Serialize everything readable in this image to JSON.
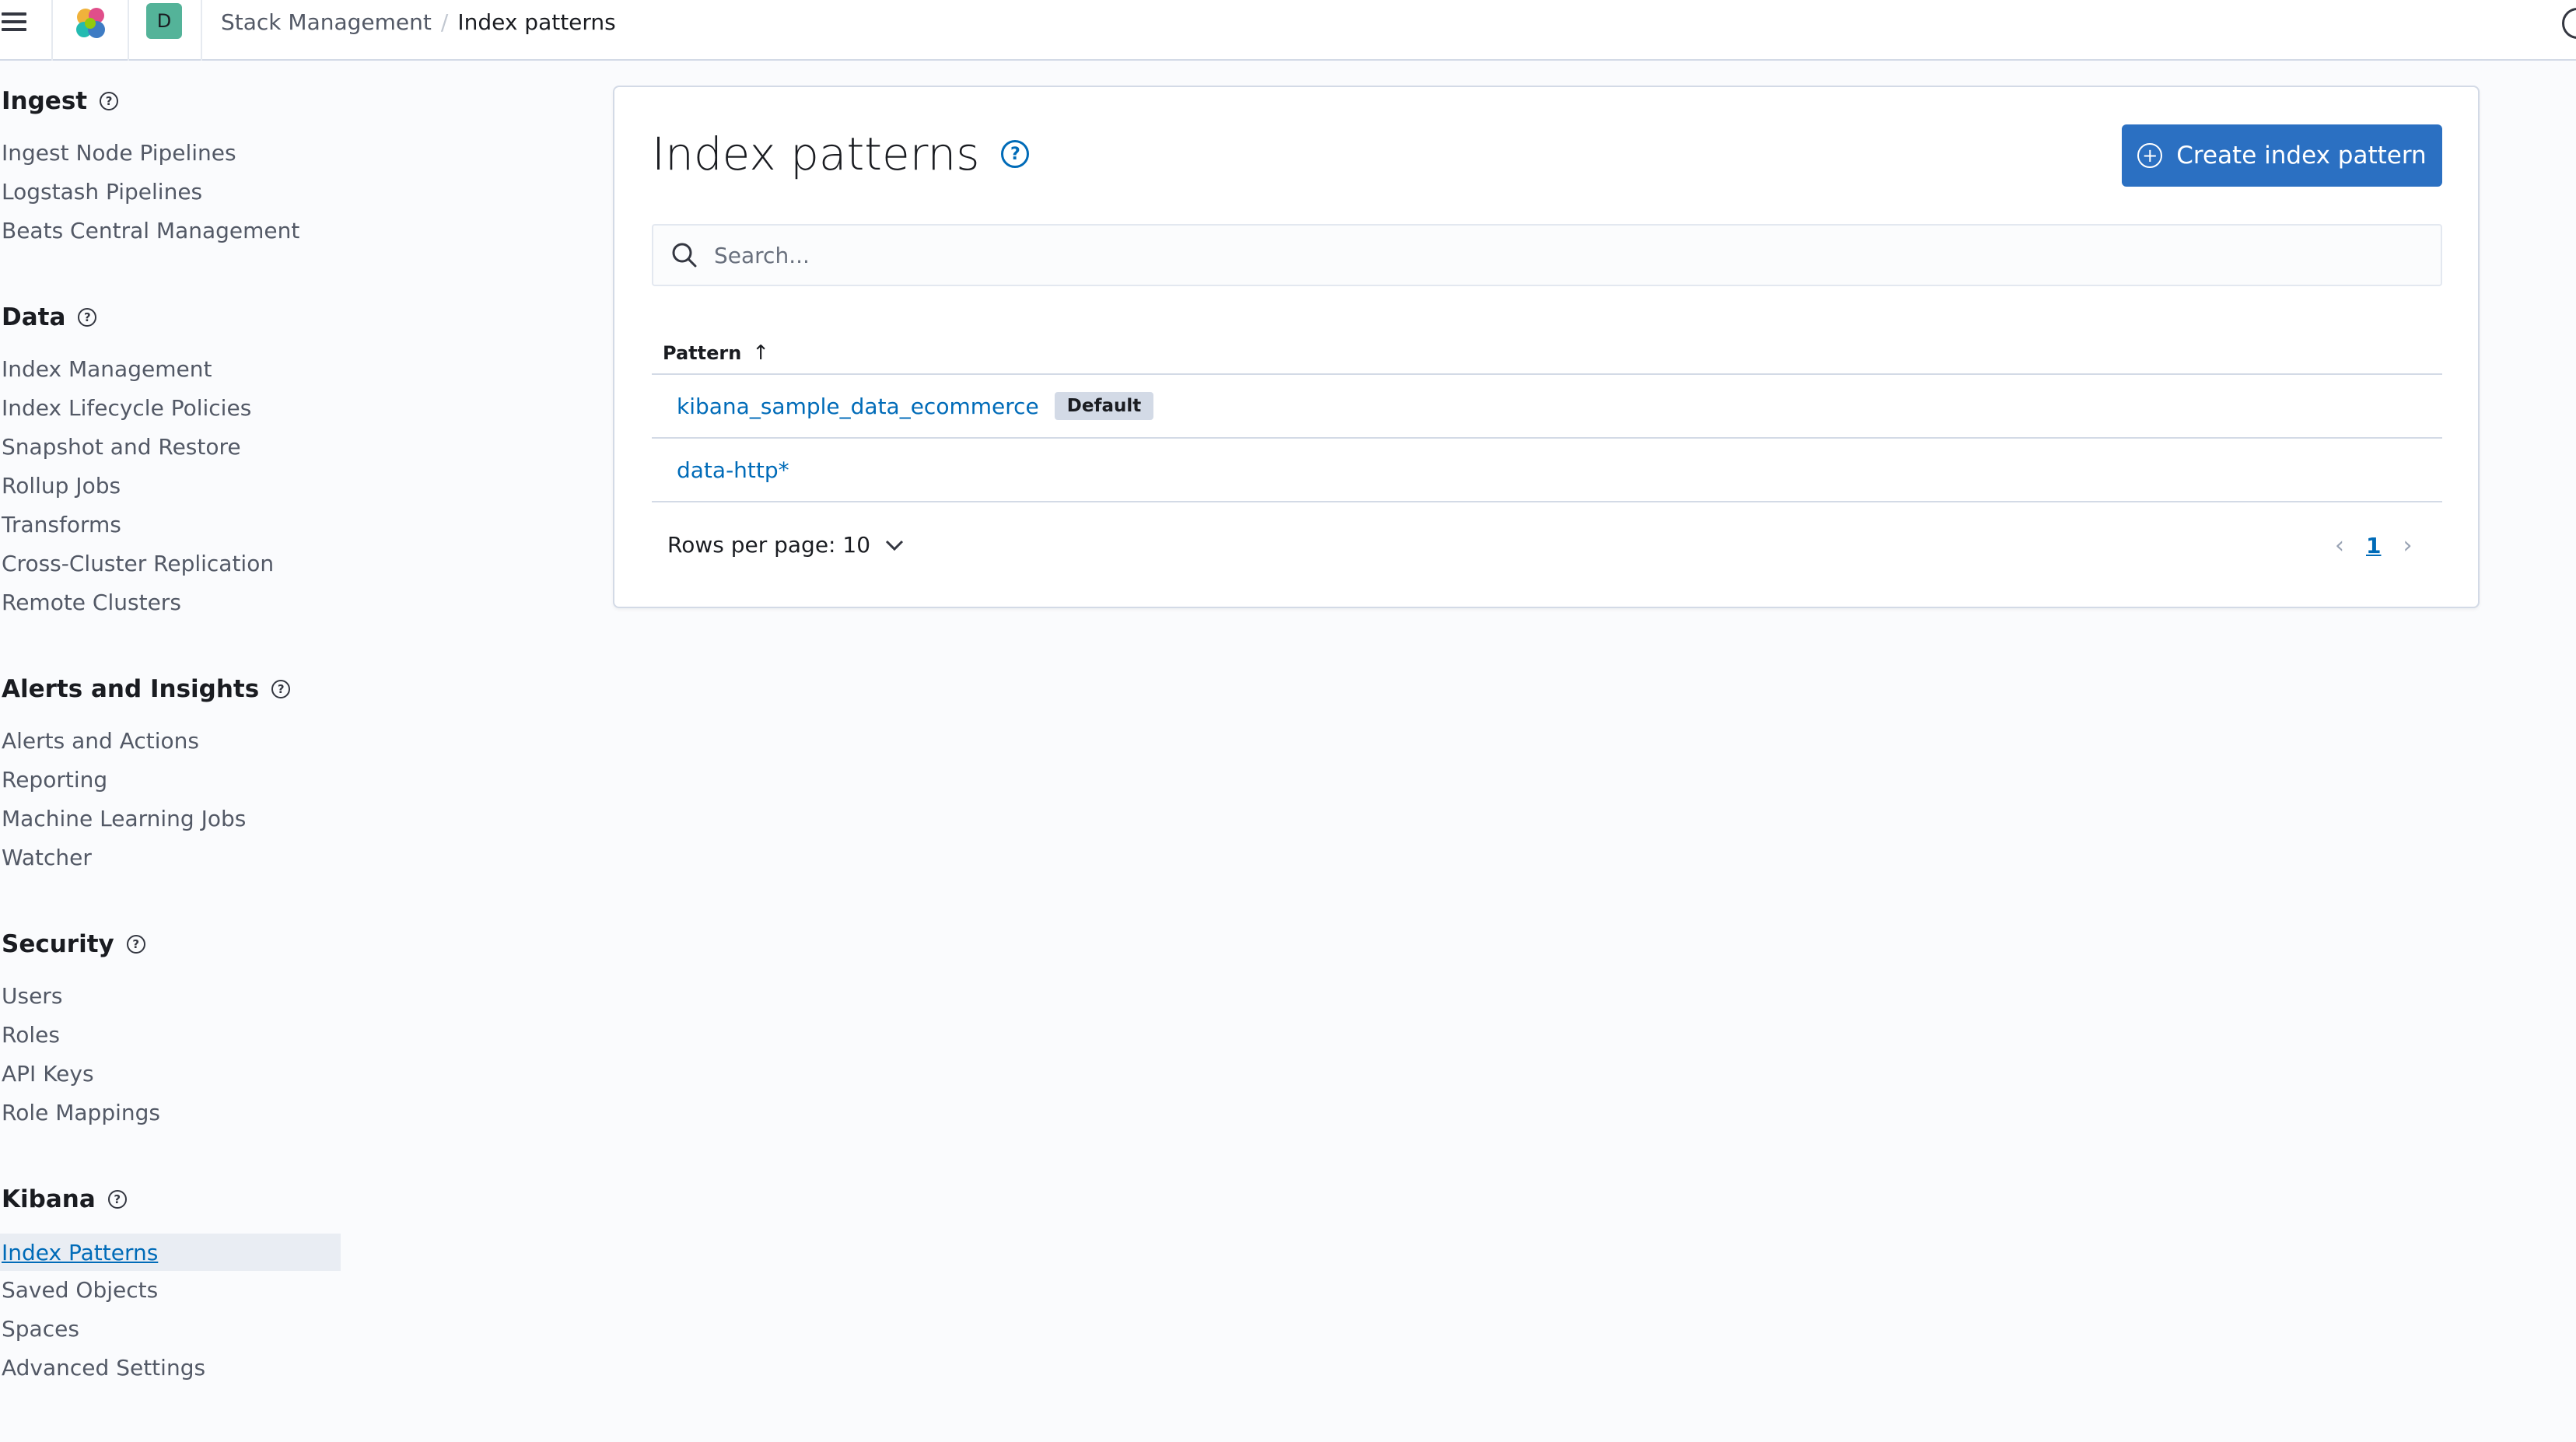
{
  "header": {
    "breadcrumbs": [
      "Stack Management",
      "Index patterns"
    ],
    "space_initial": "D"
  },
  "sidebar": {
    "sections": [
      {
        "title": "Ingest",
        "items": [
          "Ingest Node Pipelines",
          "Logstash Pipelines",
          "Beats Central Management"
        ]
      },
      {
        "title": "Data",
        "items": [
          "Index Management",
          "Index Lifecycle Policies",
          "Snapshot and Restore",
          "Rollup Jobs",
          "Transforms",
          "Cross-Cluster Replication",
          "Remote Clusters"
        ]
      },
      {
        "title": "Alerts and Insights",
        "items": [
          "Alerts and Actions",
          "Reporting",
          "Machine Learning Jobs",
          "Watcher"
        ]
      },
      {
        "title": "Security",
        "items": [
          "Users",
          "Roles",
          "API Keys",
          "Role Mappings"
        ]
      },
      {
        "title": "Kibana",
        "items": [
          "Index Patterns",
          "Saved Objects",
          "Spaces",
          "Advanced Settings"
        ]
      }
    ],
    "active_item": "Index Patterns"
  },
  "main": {
    "title": "Index patterns",
    "create_button": "Create index pattern",
    "search_placeholder": "Search...",
    "table": {
      "column": "Pattern",
      "rows": [
        {
          "pattern": "kibana_sample_data_ecommerce",
          "badge": "Default"
        },
        {
          "pattern": "data-http*",
          "badge": ""
        }
      ]
    },
    "rows_per_page": "Rows per page: 10",
    "current_page": "1"
  },
  "colors": {
    "primary": "#2b70c2",
    "link": "#006bb8",
    "avatar": "#54b399"
  }
}
